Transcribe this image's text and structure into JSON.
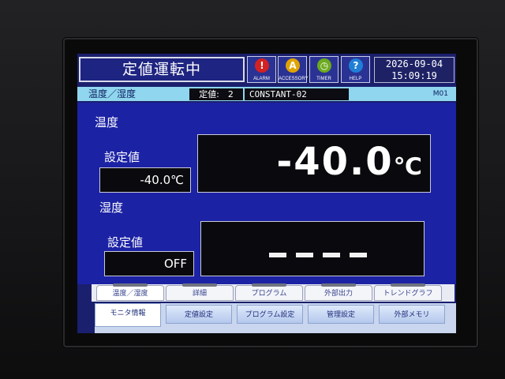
{
  "header": {
    "mode_title": "定値運転中",
    "icons": [
      {
        "name": "alarm-icon",
        "label": "ALARM",
        "glyph": "!",
        "color": "#d32222"
      },
      {
        "name": "accessory-icon",
        "label": "ACCESSORY",
        "glyph": "A",
        "color": "#e0a400"
      },
      {
        "name": "timer-icon",
        "label": "TIMER",
        "glyph": "◷",
        "color": "#6caa1e"
      },
      {
        "name": "help-icon",
        "label": "HELP",
        "glyph": "?",
        "color": "#1f7fd6"
      }
    ],
    "date": "2026-09-04",
    "time": "15:09:19"
  },
  "subbar": {
    "section": "温度／湿度",
    "constant_label": "定値:　2",
    "program_name": "CONSTANT-02",
    "code": "M01"
  },
  "temperature": {
    "title": "温度",
    "setpoint_label": "設定値",
    "setpoint_value": "-40.0℃",
    "current_value": "-40.0",
    "unit": "℃"
  },
  "humidity": {
    "title": "湿度",
    "setpoint_label": "設定値",
    "setpoint_value": "OFF",
    "current_value": "----"
  },
  "subtabs": [
    "温度／湿度",
    "詳細",
    "プログラム",
    "外部出力",
    "トレンドグラフ"
  ],
  "maintabs": [
    "モニタ情報",
    "定値設定",
    "プログラム設定",
    "管理設定",
    "外部メモリ"
  ]
}
